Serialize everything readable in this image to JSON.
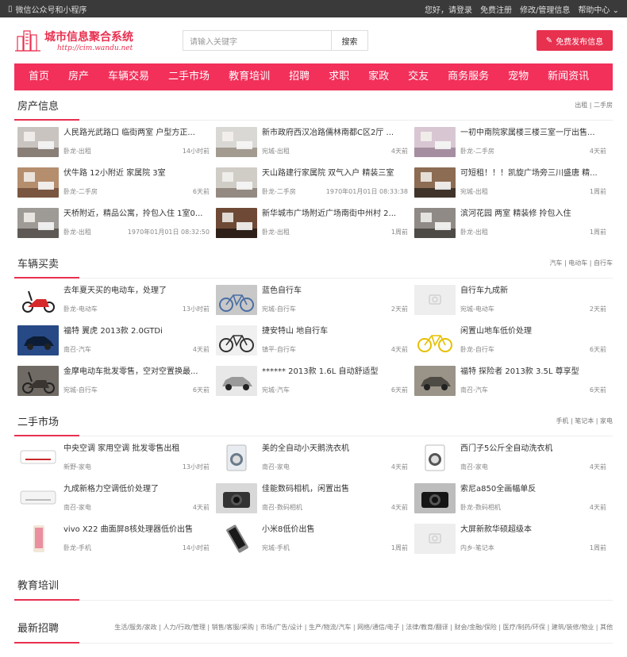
{
  "topbar": {
    "left": "微信公众号和小程序",
    "right": [
      "您好，请登录",
      "免费注册",
      "修改/管理信息",
      "帮助中心 ⌄"
    ]
  },
  "header": {
    "site_name": "城市信息聚合系统",
    "site_url": "http://cim.wandu.net",
    "search_placeholder": "请输入关键字",
    "search_button": "搜索",
    "post_button": "免费发布信息"
  },
  "nav": [
    "首页",
    "房产",
    "车辆交易",
    "二手市场",
    "教育培训",
    "招聘",
    "求职",
    "家政",
    "交友",
    "商务服务",
    "宠物",
    "新闻资讯"
  ],
  "sections": [
    {
      "title": "房产信息",
      "links": "出租 | 二手房",
      "items": [
        {
          "title": "人民路光武路口 临街两室 户型方正...",
          "meta": "卧龙-出租",
          "time": "14小时前",
          "img": "room-white",
          "colors": [
            "#c9c4c0",
            "#8a7f77"
          ]
        },
        {
          "title": "新市政府西汉冶路儒林南都C区2厅 ...",
          "meta": "宛城-出租",
          "time": "4天前",
          "img": "room-white",
          "colors": [
            "#d9d8d4",
            "#a39b90"
          ]
        },
        {
          "title": "一初中南院家属楼三楼三室一厅出售...",
          "meta": "卧龙-二手房",
          "time": "4天前",
          "img": "room-pink",
          "colors": [
            "#d8c7d2",
            "#a48ea0"
          ]
        },
        {
          "title": "伏牛路 12小附近 家属院 3室",
          "meta": "卧龙-二手房",
          "time": "6天前",
          "img": "room-warm",
          "colors": [
            "#b58e6e",
            "#7a5640"
          ]
        },
        {
          "title": "天山路建行家属院 双气入户 精装三室",
          "meta": "卧龙-二手房",
          "time": "1970年01月01日 08:33:38",
          "img": "room-white",
          "colors": [
            "#d0ccc6",
            "#948a82"
          ]
        },
        {
          "title": "可短租！！！凯旋广场旁三川盛唐 精...",
          "meta": "宛城-出租",
          "time": "1周前",
          "img": "room-dark",
          "colors": [
            "#8c6c52",
            "#40342a"
          ]
        },
        {
          "title": "天桥附近，精品公寓，拎包入住 1室0...",
          "meta": "卧龙-出租",
          "time": "1970年01月01日 08:32:50",
          "img": "room-grey",
          "colors": [
            "#9e9a96",
            "#5e5954"
          ]
        },
        {
          "title": "新华城市广场附近广场南街中州村 2...",
          "meta": "卧龙-出租",
          "time": "1周前",
          "img": "room-dark",
          "colors": [
            "#6e4a36",
            "#2e2018"
          ]
        },
        {
          "title": "滨河花园 两室 精装修 拎包入住",
          "meta": "卧龙-出租",
          "time": "1周前",
          "img": "room-grey",
          "colors": [
            "#8f8a85",
            "#4e4a46"
          ]
        }
      ]
    },
    {
      "title": "车辆买卖",
      "links": "汽车 | 电动车 | 自行车",
      "items": [
        {
          "title": "去年夏天买的电动车，处理了",
          "meta": "卧龙-电动车",
          "time": "13小时前",
          "img": "scooter",
          "colors": [
            "#ffffff",
            "#d62a2a"
          ]
        },
        {
          "title": "蓝色自行车",
          "meta": "宛城-自行车",
          "time": "2天前",
          "img": "bike",
          "colors": [
            "#c8c8c8",
            "#4a6fa5"
          ]
        },
        {
          "title": "自行车九成新",
          "meta": "宛城-电动车",
          "time": "2天前",
          "img": "placeholder",
          "colors": [
            "#eeeeee",
            "#cccccc"
          ]
        },
        {
          "title": "福特 翼虎 2013款 2.0GTDi",
          "meta": "南召-汽车",
          "time": "4天前",
          "img": "car-blue",
          "colors": [
            "#274a86",
            "#0d1c35"
          ]
        },
        {
          "title": "捷安特山 地自行车",
          "meta": "镇平-自行车",
          "time": "4天前",
          "img": "bike",
          "colors": [
            "#f0f0f0",
            "#333333"
          ]
        },
        {
          "title": "闲置山地车低价处理",
          "meta": "卧龙-自行车",
          "time": "6天前",
          "img": "bike",
          "colors": [
            "#ffffff",
            "#e5c000"
          ]
        },
        {
          "title": "金摩电动车批发零售，空对空置换最...",
          "meta": "宛城-自行车",
          "time": "6天前",
          "img": "scooter",
          "colors": [
            "#6f6a63",
            "#3a3530"
          ]
        },
        {
          "title": "****** 2013款 1.6L 自动舒适型",
          "meta": "宛城-汽车",
          "time": "6天前",
          "img": "car-white",
          "colors": [
            "#e8e8e8",
            "#9a9a9a"
          ]
        },
        {
          "title": "福特 探险者 2013款 3.5L 尊享型",
          "meta": "南召-汽车",
          "time": "6天前",
          "img": "car-grey",
          "colors": [
            "#9a9388",
            "#4e4a44"
          ]
        }
      ]
    },
    {
      "title": "二手市场",
      "links": "手机 | 笔记本 | 家电",
      "items": [
        {
          "title": "中央空调 家用空调 批发零售出租",
          "meta": "新野-家电",
          "time": "13小时前",
          "img": "ac",
          "colors": [
            "#ffffff",
            "#c72a2a"
          ]
        },
        {
          "title": "美的全自动小天鹅洗衣机",
          "meta": "南召-家电",
          "time": "4天前",
          "img": "washer",
          "colors": [
            "#e8ecf0",
            "#6a7a8a"
          ]
        },
        {
          "title": "西门子5公斤全自动洗衣机",
          "meta": "南召-家电",
          "time": "4天前",
          "img": "washer",
          "colors": [
            "#ffffff",
            "#555555"
          ]
        },
        {
          "title": "九成新格力空调低价处理了",
          "meta": "南召-家电",
          "time": "4天前",
          "img": "ac",
          "colors": [
            "#f4f4f4",
            "#bbbbbb"
          ]
        },
        {
          "title": "佳能数码相机，闲置出售",
          "meta": "南召-数码相机",
          "time": "4天前",
          "img": "camera",
          "colors": [
            "#d8d8d8",
            "#333333"
          ]
        },
        {
          "title": "索尼a850全画幅单反",
          "meta": "卧龙-数码相机",
          "time": "4天前",
          "img": "camera",
          "colors": [
            "#bdbdbd",
            "#151515"
          ]
        },
        {
          "title": "vivo X22 曲面屏8核处理器低价出售",
          "meta": "卧龙-手机",
          "time": "14小时前",
          "img": "phone",
          "colors": [
            "#f2e6d8",
            "#e98fa0"
          ]
        },
        {
          "title": "小米8低价出售",
          "meta": "宛城-手机",
          "time": "1周前",
          "img": "phone-dark",
          "colors": [
            "#888888",
            "#1a1a1a"
          ]
        },
        {
          "title": "大屏新款华硕超级本",
          "meta": "内乡-笔记本",
          "time": "1周前",
          "img": "placeholder",
          "colors": [
            "#eeeeee",
            "#cccccc"
          ]
        }
      ]
    }
  ],
  "edu": {
    "title": "教育培训",
    "links": ""
  },
  "jobs": {
    "title": "最新招聘",
    "links": "生活/服务/家政 | 人力/行政/管理 | 销售/客服/采购 | 市场/广告/设计 | 生产/物流/汽车 | 网络/通信/电子 | 法律/教育/翻译 | 财会/金融/保险 | 医疗/制药/环保 | 建筑/装修/物业 | 其他"
  }
}
